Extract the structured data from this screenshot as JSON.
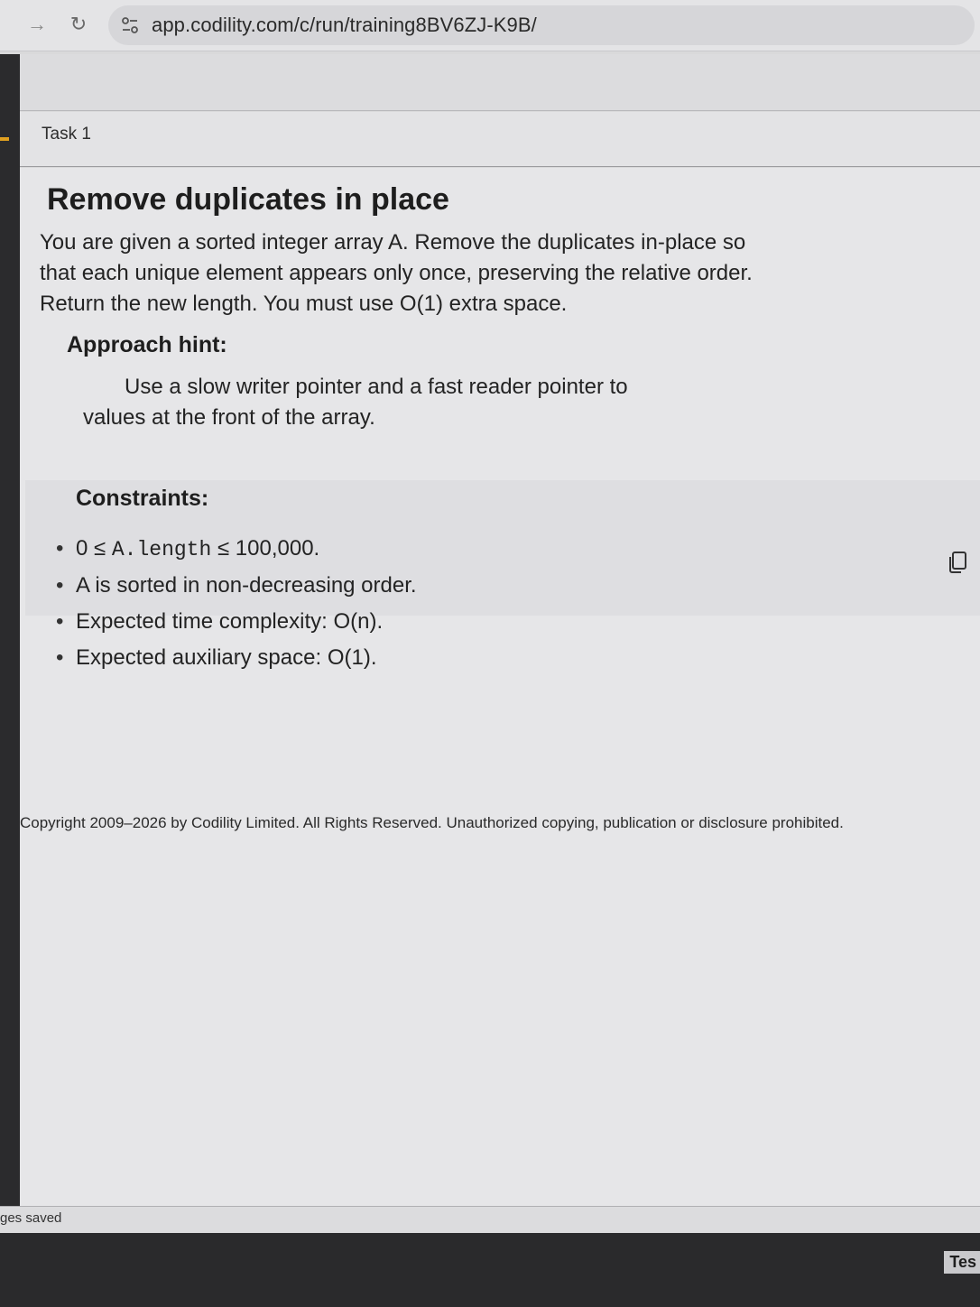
{
  "browser": {
    "url": "app.codility.com/c/run/training8BV6ZJ-K9B/",
    "forward_icon": "arrow-right-icon",
    "reload_icon": "reload-icon",
    "site_info_icon": "tune-icon"
  },
  "task_tab": {
    "label": "Task 1"
  },
  "task": {
    "title": "Remove duplicates in place",
    "description": "You are given a sorted integer array A. Remove the duplicates in-place so that each unique element appears only once, preserving the relative order. Return the new length. You must use O(1) extra space.",
    "hint_heading": "Approach hint:",
    "hint_text": "Use a slow writer pointer and a fast reader pointer to values at the front of the array.",
    "constraints_heading": "Constraints:",
    "constraints": [
      {
        "prefix": "0 ≤ ",
        "code": "A.length",
        "suffix": " ≤ 100,000."
      },
      {
        "prefix": "A is sorted in non-decreasing order.",
        "code": "",
        "suffix": ""
      },
      {
        "prefix": "Expected time complexity: O(n).",
        "code": "",
        "suffix": ""
      },
      {
        "prefix": "Expected auxiliary space: O(1).",
        "code": "",
        "suffix": ""
      }
    ],
    "copy_icon": "copy-icon"
  },
  "footer": {
    "copyright": "Copyright 2009–2026 by Codility Limited. All Rights Reserved. Unauthorized copying, publication or disclosure prohibited.",
    "save_status": "ges saved",
    "bottom_right_label": "Tes"
  },
  "colors": {
    "rail": "#2b2b2d",
    "accent": "#e0a020",
    "background": "#e6e6e8"
  }
}
